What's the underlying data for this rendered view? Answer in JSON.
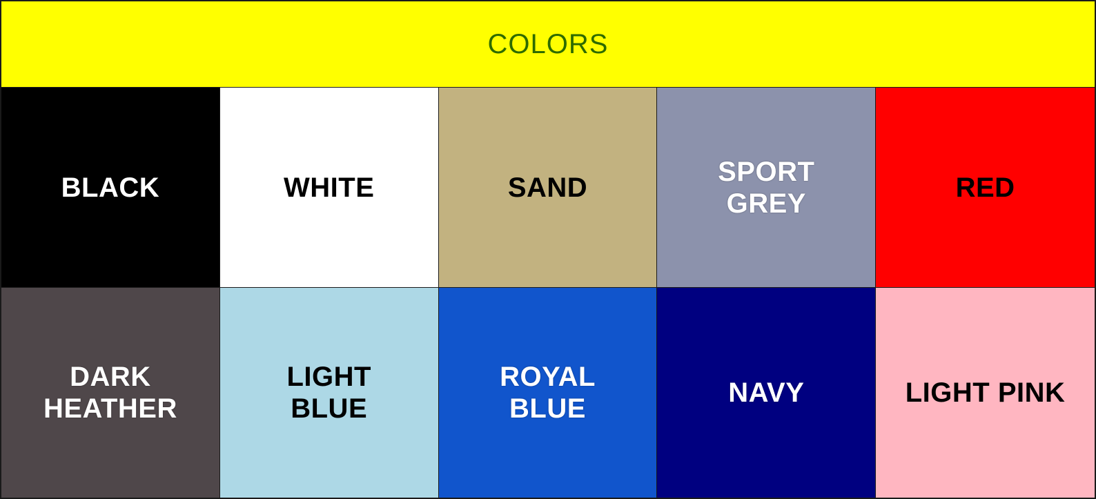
{
  "header": {
    "title": "COLORS",
    "background": "#ffff00",
    "text_color": "#2e6b00"
  },
  "rows": [
    [
      {
        "label": "BLACK",
        "bg": "#000000",
        "fg": "#ffffff",
        "icon": "black-swatch"
      },
      {
        "label": "WHITE",
        "bg": "#ffffff",
        "fg": "#000000",
        "icon": "white-swatch"
      },
      {
        "label": "SAND",
        "bg": "#c2b280",
        "fg": "#000000",
        "icon": "sand-swatch"
      },
      {
        "label": "SPORT GREY",
        "bg": "#8c92ac",
        "fg": "#ffffff",
        "icon": "sport-grey-swatch"
      },
      {
        "label": "RED",
        "bg": "#ff0000",
        "fg": "#000000",
        "icon": "red-swatch"
      }
    ],
    [
      {
        "label": "DARK HEATHER",
        "bg": "#4f474a",
        "fg": "#ffffff",
        "icon": "dark-heather-swatch"
      },
      {
        "label": "LIGHT BLUE",
        "bg": "#add8e6",
        "fg": "#000000",
        "icon": "light-blue-swatch"
      },
      {
        "label": "ROYAL BLUE",
        "bg": "#1155cc",
        "fg": "#ffffff",
        "icon": "royal-blue-swatch"
      },
      {
        "label": "NAVY",
        "bg": "#000080",
        "fg": "#ffffff",
        "icon": "navy-swatch"
      },
      {
        "label": "LIGHT PINK",
        "bg": "#ffb6c1",
        "fg": "#000000",
        "icon": "light-pink-swatch"
      }
    ]
  ]
}
